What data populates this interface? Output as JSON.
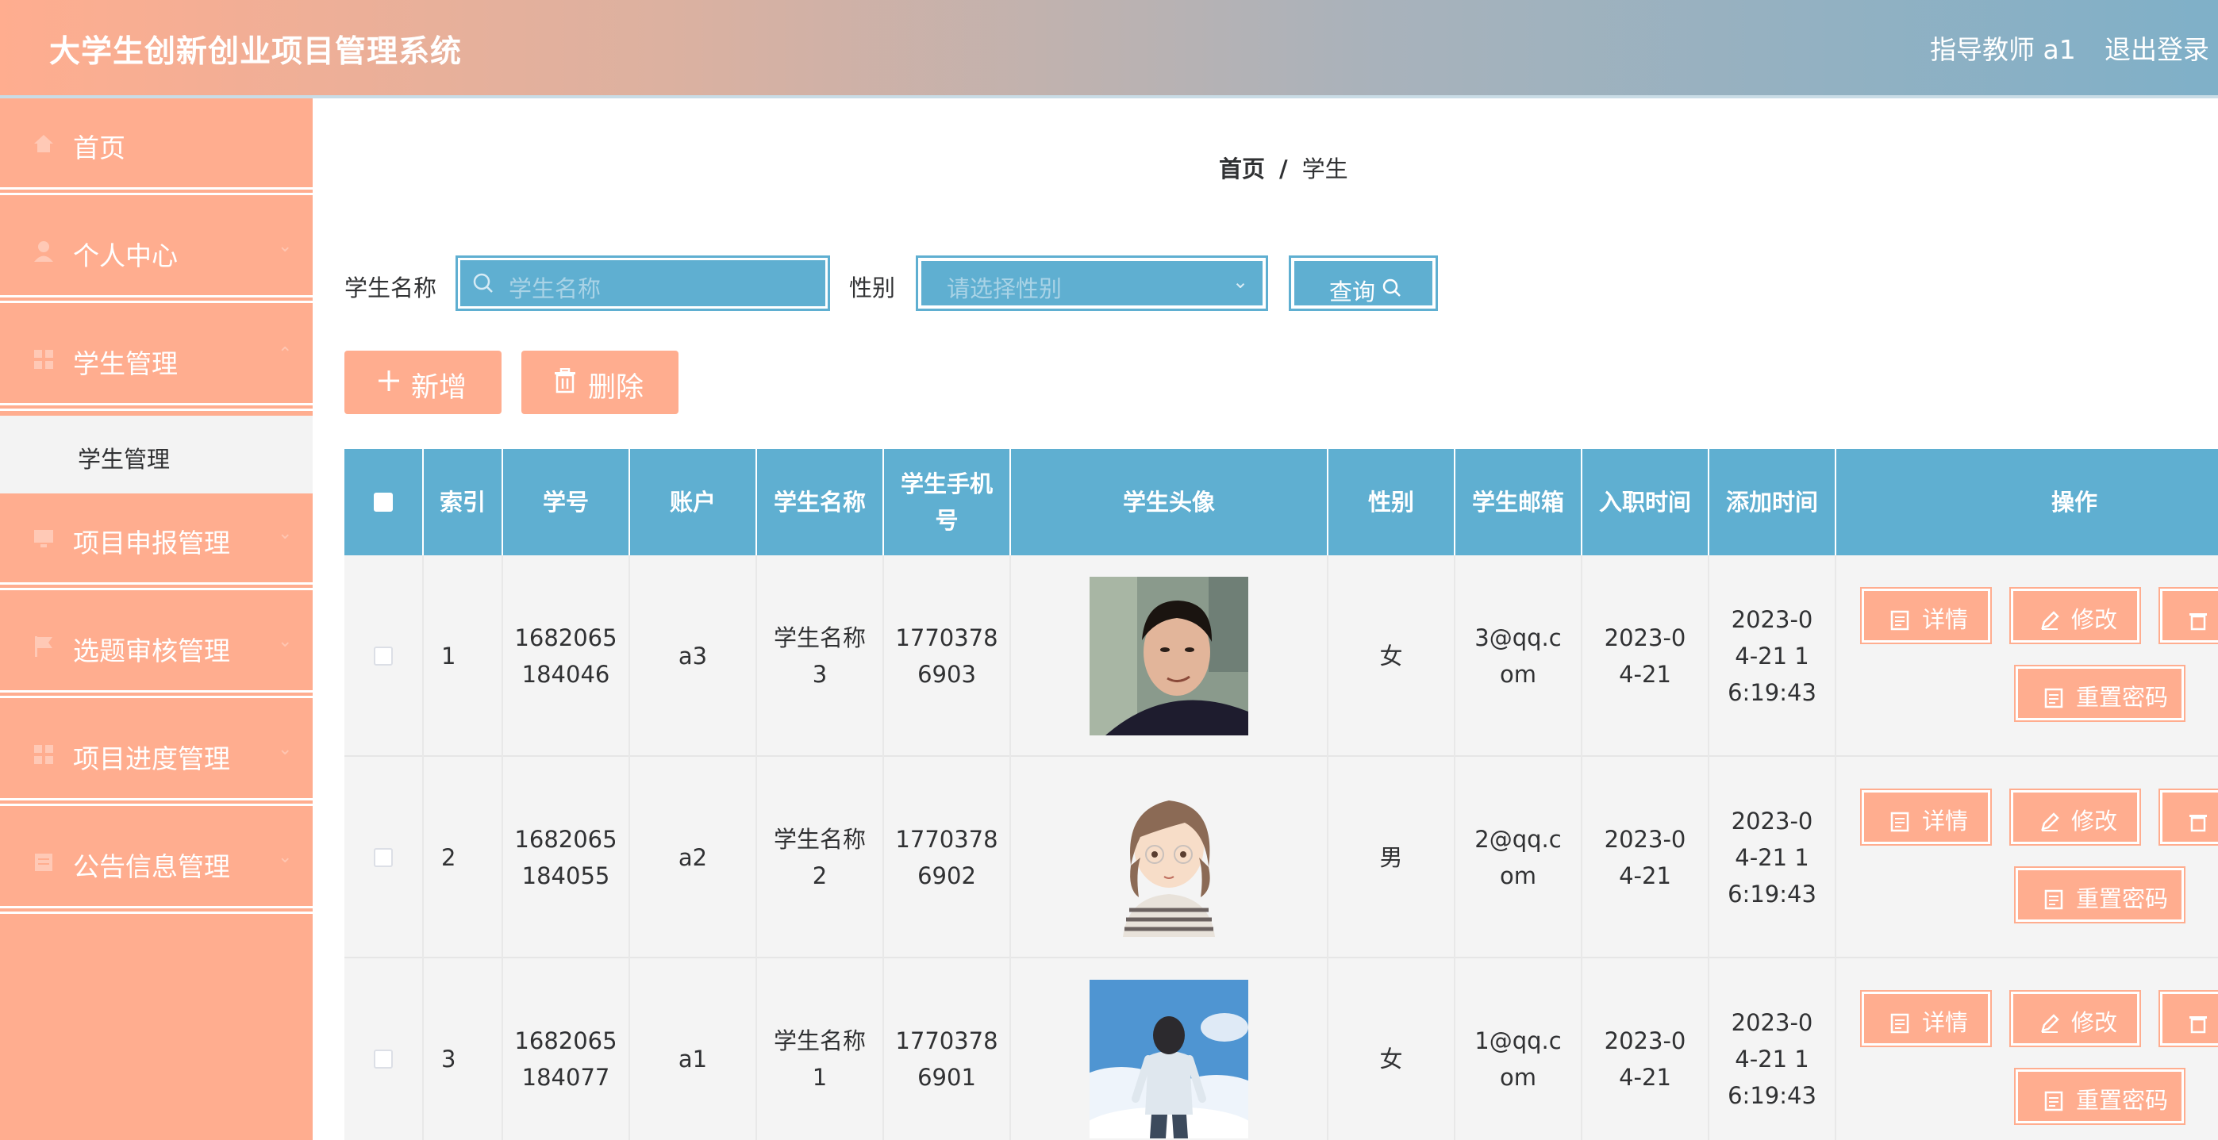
{
  "header": {
    "app_title": "大学生创新创业项目管理系统",
    "user": "指导教师 a1",
    "logout": "退出登录"
  },
  "sidebar": {
    "items": [
      {
        "label": "首页",
        "icon": "home-icon"
      },
      {
        "label": "个人中心",
        "icon": "user-icon"
      },
      {
        "label": "学生管理",
        "icon": "grid-icon"
      },
      {
        "label": "项目申报管理",
        "icon": "monitor-icon"
      },
      {
        "label": "选题审核管理",
        "icon": "flag-icon"
      },
      {
        "label": "项目进度管理",
        "icon": "grid-icon"
      },
      {
        "label": "公告信息管理",
        "icon": "document-icon"
      }
    ],
    "active_sub": "学生管理"
  },
  "breadcrumb": {
    "home": "首页",
    "separator": "/",
    "current": "学生"
  },
  "search": {
    "name_label": "学生名称",
    "name_placeholder": "学生名称",
    "gender_label": "性别",
    "gender_placeholder": "请选择性别",
    "query_button": "查询"
  },
  "actions": {
    "add": "新增",
    "delete": "删除"
  },
  "table": {
    "columns": [
      "索引",
      "学号",
      "账户",
      "学生名称",
      "学生手机号",
      "学生头像",
      "性别",
      "学生邮箱",
      "入职时间",
      "添加时间",
      "操作"
    ],
    "rows": [
      {
        "index": "1",
        "student_no": "1682065184046",
        "account": "a3",
        "name": "学生名称3",
        "phone": "17703786903",
        "avatar": "student avatar 3",
        "gender": "女",
        "email": "3@qq.com",
        "join_date": "2023-04-21",
        "added": "2023-04-21 16:19:43"
      },
      {
        "index": "2",
        "student_no": "1682065184055",
        "account": "a2",
        "name": "学生名称2",
        "phone": "17703786902",
        "avatar": "student avatar 2",
        "gender": "男",
        "email": "2@qq.com",
        "join_date": "2023-04-21",
        "added": "2023-04-21 16:19:43"
      },
      {
        "index": "3",
        "student_no": "1682065184077",
        "account": "a1",
        "name": "学生名称1",
        "phone": "17703786901",
        "avatar": "student avatar 1",
        "gender": "女",
        "email": "1@qq.com",
        "join_date": "2023-04-21",
        "added": "2023-04-21 16:19:43"
      }
    ],
    "row_actions": {
      "detail": "详情",
      "edit": "修改",
      "reset_password": "重置密码"
    }
  },
  "colors": {
    "primary_blue": "#5fafd1",
    "salmon": "#ffad8f",
    "header_gradient": [
      "#ffad8f",
      "#7fb0c8"
    ]
  }
}
